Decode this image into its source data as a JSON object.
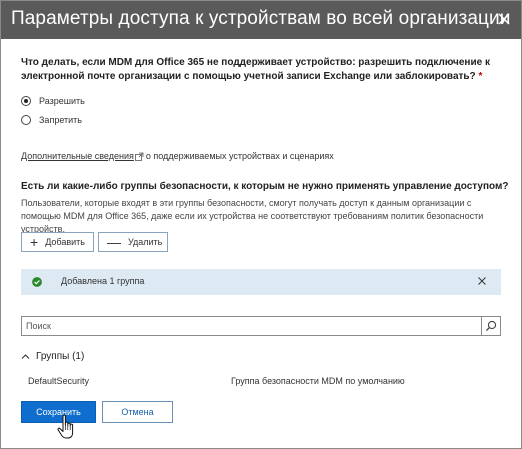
{
  "dialog": {
    "title": "Параметры доступа к устройствам во всей организации",
    "close_icon": "close-icon"
  },
  "unsupported": {
    "question": "Что делать, если MDM для Office 365 не поддерживает устройство: разрешить подключение к электронной почте организации с помощью учетной записи Exchange или заблокировать?",
    "required_mark": "*",
    "options": [
      {
        "label": "Разрешить",
        "checked": true
      },
      {
        "label": "Запретить",
        "checked": false
      }
    ]
  },
  "more_info": {
    "link_text": "Дополнительные сведения",
    "suffix": "о поддерживаемых устройствах и сценариях",
    "icon": "external-link-icon"
  },
  "security_groups": {
    "title": "Есть ли какие-либо группы безопасности, к которым не нужно применять управление доступом?",
    "description": "Пользователи, которые входят в эти группы безопасности, смогут получать доступ к данным организации с помощью MDM для Office 365, даже если их устройства не соответствуют требованиям политик безопасности устройств.",
    "add_symbol": "+",
    "add_label": "Добавить",
    "remove_symbol": "—",
    "remove_label": "Удалить"
  },
  "notification": {
    "text": "Добавлена 1 группа",
    "status_color": "#2a8a2a",
    "background": "#dde9f3"
  },
  "search": {
    "placeholder": "Поиск",
    "value": ""
  },
  "groups": {
    "header": "Группы (1)",
    "items": [
      {
        "name": "DefaultSecurity",
        "description": "Группа безопасности MDM по умолчанию"
      }
    ]
  },
  "footer": {
    "save_label": "Сохранить",
    "cancel_label": "Отмена",
    "accent_color": "#0f6ecd"
  }
}
